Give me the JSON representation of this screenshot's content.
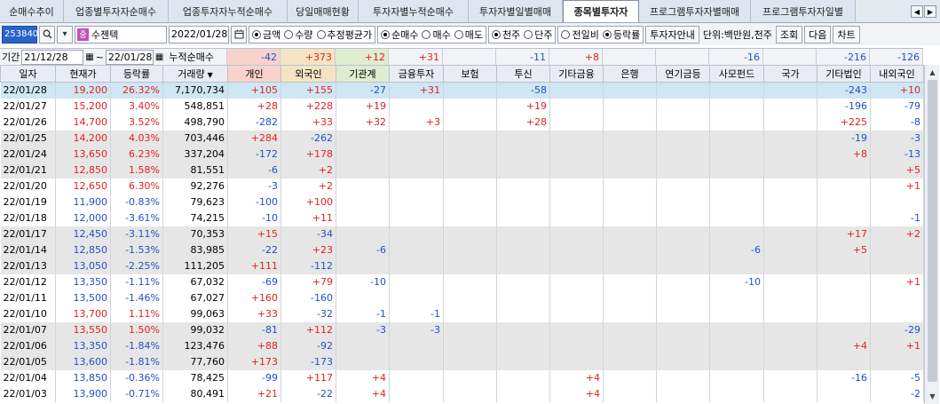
{
  "tabs": [
    "순매수추이",
    "업종별투자자순매수",
    "업종투자자누적순매수",
    "당일매매현황",
    "투자자별누적순매수",
    "투자자별일별매매",
    "종목별투자자",
    "프로그램투자자별매매",
    "프로그램투자자일별"
  ],
  "active_tab": 6,
  "toolbar": {
    "code": "253840",
    "stock_name": "수젠텍",
    "badge": "중",
    "date": "2022/01/28",
    "amount_options": [
      "금액",
      "수량",
      "추정평균가"
    ],
    "amount_selected": 0,
    "trade_options": [
      "순매수",
      "매수",
      "매도"
    ],
    "trade_selected": 0,
    "unit_options": [
      "천주",
      "단주"
    ],
    "unit_selected": 0,
    "compare_options": [
      "전일비",
      "등락률"
    ],
    "compare_selected": 1,
    "guide_label": "투자자안내",
    "unit_text": "단위:백만원,천주",
    "query_label": "조회",
    "next_label": "다음",
    "chart_label": "차트"
  },
  "period": {
    "label": "기간",
    "start": "21/12/28",
    "end": "22/01/28",
    "cumulative_label": "누적순매수",
    "totals": [
      "-42",
      "+373",
      "+12",
      "+31",
      "",
      "-11",
      "+8",
      "",
      "",
      "-16",
      "",
      "-216",
      "-126"
    ]
  },
  "columns": [
    "일자",
    "현재가",
    "등락률",
    "거래량",
    "개인",
    "외국인",
    "기관계",
    "금융투자",
    "보험",
    "투신",
    "기타금융",
    "은행",
    "연기금등",
    "사모펀드",
    "국가",
    "기타법인",
    "내외국인"
  ],
  "colors": {
    "up": "#e0221f",
    "down": "#1f50c8",
    "selected_row": "#cfe6f3",
    "shade_row": "#e6e6e6",
    "personal_header": "#f7d3cc",
    "foreign_header": "#f4e4c4",
    "inst_header": "#dfeccf"
  },
  "rows": [
    {
      "date": "22/01/28",
      "price": "19,200",
      "rate": "26.32%",
      "volume": "7,170,734",
      "v": [
        "+105",
        "+155",
        "-27",
        "+31",
        "",
        "-58",
        "",
        "",
        "",
        "",
        "",
        "-243",
        "+10"
      ],
      "style": "sel"
    },
    {
      "date": "22/01/27",
      "price": "15,200",
      "rate": "3.40%",
      "volume": "548,851",
      "v": [
        "+28",
        "+228",
        "+19",
        "",
        "",
        "+19",
        "",
        "",
        "",
        "",
        "",
        "-196",
        "-79"
      ],
      "style": ""
    },
    {
      "date": "22/01/26",
      "price": "14,700",
      "rate": "3.52%",
      "volume": "498,790",
      "v": [
        "-282",
        "+33",
        "+32",
        "+3",
        "",
        "+28",
        "",
        "",
        "",
        "",
        "",
        "+225",
        "-8"
      ],
      "style": ""
    },
    {
      "date": "22/01/25",
      "price": "14,200",
      "rate": "4.03%",
      "volume": "703,446",
      "v": [
        "+284",
        "-262",
        "",
        "",
        "",
        "",
        "",
        "",
        "",
        "",
        "",
        "-19",
        "-3"
      ],
      "style": "shade"
    },
    {
      "date": "22/01/24",
      "price": "13,650",
      "rate": "6.23%",
      "volume": "337,204",
      "v": [
        "-172",
        "+178",
        "",
        "",
        "",
        "",
        "",
        "",
        "",
        "",
        "",
        "+8",
        "-13"
      ],
      "style": "shade"
    },
    {
      "date": "22/01/21",
      "price": "12,850",
      "rate": "1.58%",
      "volume": "81,551",
      "v": [
        "-6",
        "+2",
        "",
        "",
        "",
        "",
        "",
        "",
        "",
        "",
        "",
        "",
        "+5"
      ],
      "style": "shade"
    },
    {
      "date": "22/01/20",
      "price": "12,650",
      "rate": "6.30%",
      "volume": "92,276",
      "v": [
        "-3",
        "+2",
        "",
        "",
        "",
        "",
        "",
        "",
        "",
        "",
        "",
        "",
        "+1"
      ],
      "style": ""
    },
    {
      "date": "22/01/19",
      "price": "11,900",
      "rate": "-0.83%",
      "volume": "79,623",
      "v": [
        "-100",
        "+100",
        "",
        "",
        "",
        "",
        "",
        "",
        "",
        "",
        "",
        "",
        ""
      ],
      "style": ""
    },
    {
      "date": "22/01/18",
      "price": "12,000",
      "rate": "-3.61%",
      "volume": "74,215",
      "v": [
        "-10",
        "+11",
        "",
        "",
        "",
        "",
        "",
        "",
        "",
        "",
        "",
        "",
        "-1"
      ],
      "style": ""
    },
    {
      "date": "22/01/17",
      "price": "12,450",
      "rate": "-3.11%",
      "volume": "70,353",
      "v": [
        "+15",
        "-34",
        "",
        "",
        "",
        "",
        "",
        "",
        "",
        "",
        "",
        "+17",
        "+2"
      ],
      "style": "shade"
    },
    {
      "date": "22/01/14",
      "price": "12,850",
      "rate": "-1.53%",
      "volume": "83,985",
      "v": [
        "-22",
        "+23",
        "-6",
        "",
        "",
        "",
        "",
        "",
        "",
        "-6",
        "",
        "+5",
        ""
      ],
      "style": "shade"
    },
    {
      "date": "22/01/13",
      "price": "13,050",
      "rate": "-2.25%",
      "volume": "111,205",
      "v": [
        "+111",
        "-112",
        "",
        "",
        "",
        "",
        "",
        "",
        "",
        "",
        "",
        "",
        ""
      ],
      "style": "shade"
    },
    {
      "date": "22/01/12",
      "price": "13,350",
      "rate": "-1.11%",
      "volume": "67,032",
      "v": [
        "-69",
        "+79",
        "-10",
        "",
        "",
        "",
        "",
        "",
        "",
        "-10",
        "",
        "",
        "+1"
      ],
      "style": ""
    },
    {
      "date": "22/01/11",
      "price": "13,500",
      "rate": "-1.46%",
      "volume": "67,027",
      "v": [
        "+160",
        "-160",
        "",
        "",
        "",
        "",
        "",
        "",
        "",
        "",
        "",
        "",
        ""
      ],
      "style": ""
    },
    {
      "date": "22/01/10",
      "price": "13,700",
      "rate": "1.11%",
      "volume": "99,063",
      "v": [
        "+33",
        "-32",
        "-1",
        "-1",
        "",
        "",
        "",
        "",
        "",
        "",
        "",
        "",
        ""
      ],
      "style": ""
    },
    {
      "date": "22/01/07",
      "price": "13,550",
      "rate": "1.50%",
      "volume": "99,032",
      "v": [
        "-81",
        "+112",
        "-3",
        "-3",
        "",
        "",
        "",
        "",
        "",
        "",
        "",
        "",
        "-29"
      ],
      "style": "shade"
    },
    {
      "date": "22/01/06",
      "price": "13,350",
      "rate": "-1.84%",
      "volume": "123,476",
      "v": [
        "+88",
        "-92",
        "",
        "",
        "",
        "",
        "",
        "",
        "",
        "",
        "",
        "+4",
        "+1"
      ],
      "style": "shade"
    },
    {
      "date": "22/01/05",
      "price": "13,600",
      "rate": "-1.81%",
      "volume": "77,760",
      "v": [
        "+173",
        "-173",
        "",
        "",
        "",
        "",
        "",
        "",
        "",
        "",
        "",
        "",
        ""
      ],
      "style": "shade"
    },
    {
      "date": "22/01/04",
      "price": "13,850",
      "rate": "-0.36%",
      "volume": "78,425",
      "v": [
        "-99",
        "+117",
        "+4",
        "",
        "",
        "",
        "+4",
        "",
        "",
        "",
        "",
        "-16",
        "-5"
      ],
      "style": ""
    },
    {
      "date": "22/01/03",
      "price": "13,900",
      "rate": "-0.71%",
      "volume": "80,491",
      "v": [
        "+21",
        "-22",
        "+4",
        "",
        "",
        "",
        "+4",
        "",
        "",
        "",
        "",
        "",
        "-2"
      ],
      "style": ""
    }
  ]
}
